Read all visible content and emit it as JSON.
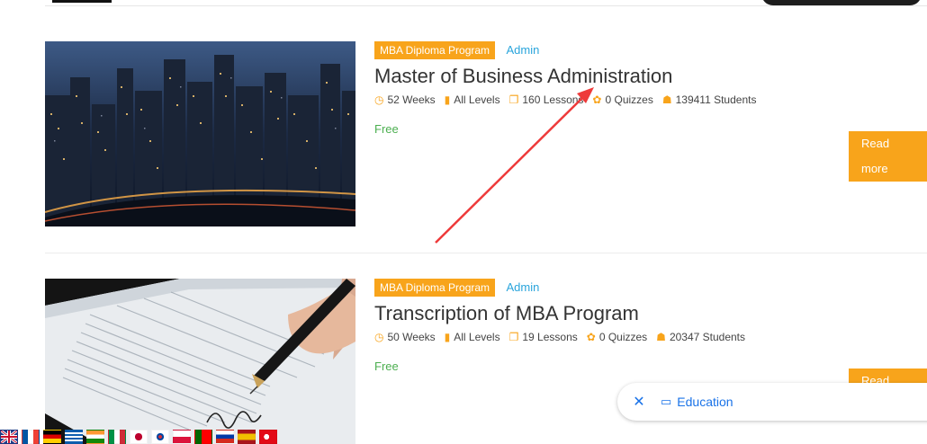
{
  "courses": [
    {
      "category": "MBA Diploma Program",
      "author": "Admin",
      "title": "Master of Business Administration",
      "meta": {
        "duration": "52 Weeks",
        "level": "All Levels",
        "lessons": "160 Lessons",
        "quizzes": "0 Quizzes",
        "students": "139411 Students"
      },
      "price": "Free",
      "cta": "Read more"
    },
    {
      "category": "MBA Diploma Program",
      "author": "Admin",
      "title": "Transcription of MBA Program",
      "meta": {
        "duration": "50 Weeks",
        "level": "All Levels",
        "lessons": "19 Lessons",
        "quizzes": "0 Quizzes",
        "students": "20347 Students"
      },
      "price": "Free",
      "cta": "Read more"
    }
  ],
  "toast": {
    "close_icon": "close-icon",
    "label": "Education"
  },
  "language_flags": [
    "uk-flag",
    "france-flag",
    "germany-flag",
    "greece-flag",
    "india-flag",
    "italy-flag",
    "japan-flag",
    "south-korea-flag",
    "poland-flag",
    "portugal-flag",
    "russia-flag",
    "spain-flag",
    "turkey-flag"
  ],
  "colors": {
    "accent": "#f8a41b",
    "author_link": "#2aa5dc",
    "price": "#4caf50",
    "toast_text": "#1a73e8",
    "annotation_arrow": "#ee3a3a"
  }
}
